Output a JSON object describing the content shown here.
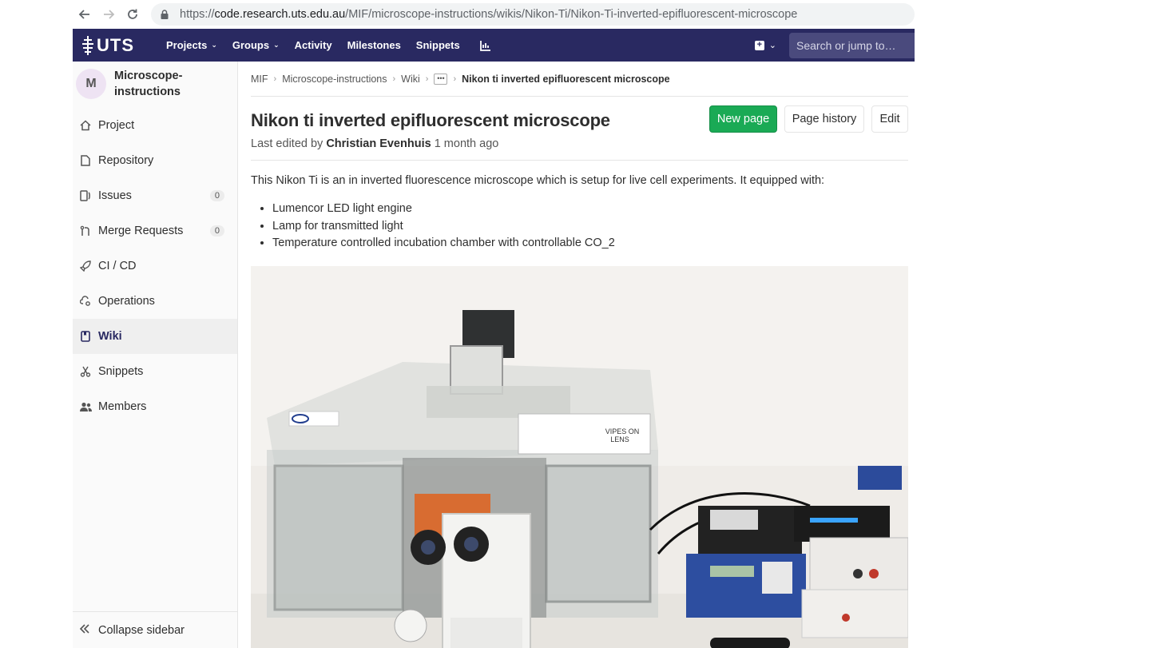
{
  "browser": {
    "url_scheme": "https://",
    "url_host": "code.research.uts.edu.au",
    "url_path": "/MIF/microscope-instructions/wikis/Nikon-Ti/Nikon-Ti-inverted-epifluorescent-microscope"
  },
  "topnav": {
    "logo_text": "UTS",
    "items": [
      "Projects",
      "Groups",
      "Activity",
      "Milestones",
      "Snippets"
    ],
    "search_placeholder": "Search or jump to…"
  },
  "sidebar": {
    "avatar_letter": "M",
    "project_name": "Microscope-instructions",
    "items": [
      {
        "label": "Project",
        "icon": "home-icon"
      },
      {
        "label": "Repository",
        "icon": "doc-icon"
      },
      {
        "label": "Issues",
        "icon": "issues-icon",
        "count": "0"
      },
      {
        "label": "Merge Requests",
        "icon": "merge-request-icon",
        "count": "0"
      },
      {
        "label": "CI / CD",
        "icon": "rocket-icon"
      },
      {
        "label": "Operations",
        "icon": "cloud-gear-icon"
      },
      {
        "label": "Wiki",
        "icon": "book-icon",
        "active": true
      },
      {
        "label": "Snippets",
        "icon": "scissors-icon"
      },
      {
        "label": "Members",
        "icon": "users-icon"
      }
    ],
    "collapse_label": "Collapse sidebar"
  },
  "breadcrumb": {
    "items": [
      "MIF",
      "Microscope-instructions",
      "Wiki"
    ],
    "current": "Nikon ti inverted epifluorescent microscope"
  },
  "page": {
    "title": "Nikon ti inverted epifluorescent microscope",
    "last_edited_prefix": "Last edited by",
    "author": "Christian Evenhuis",
    "age": "1 month ago",
    "buttons": {
      "new_page": "New page",
      "page_history": "Page history",
      "edit": "Edit"
    },
    "description": "This Nikon Ti is an in inverted fluorescence microscope which is setup for live cell experiments. It equipped with:",
    "features": [
      "Lumencor LED light engine",
      "Lamp for transmitted light",
      "Temperature controlled incubation chamber with controllable CO_2"
    ],
    "photo_sign_text": [
      "VIPES ON",
      "LENS"
    ]
  },
  "colors": {
    "navbar": "#292961",
    "primary_button": "#1aaa55",
    "sidebar_bg": "#fafafa"
  }
}
